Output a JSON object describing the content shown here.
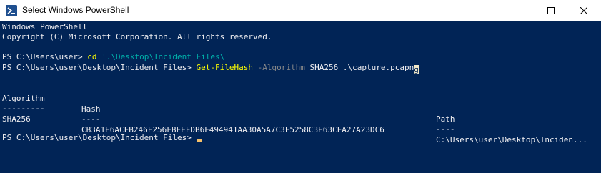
{
  "window": {
    "title": "Select Windows PowerShell",
    "controls": {
      "minimize": "minimize-icon",
      "maximize": "maximize-icon",
      "close": "close-icon"
    }
  },
  "colors": {
    "background": "#012456",
    "text": "#eeedf0",
    "command": "#ffff00",
    "string": "#00afa9",
    "parameter": "#8a8a8a"
  },
  "console": {
    "banner_line1": "Windows PowerShell",
    "banner_line2": "Copyright (C) Microsoft Corporation. All rights reserved.",
    "prompt1": "PS C:\\Users\\user> ",
    "cmd1_name": "cd",
    "cmd1_arg": " '.\\Desktop\\Incident Files\\'",
    "prompt2": "PS C:\\Users\\user\\Desktop\\Incident Files> ",
    "cmd2_name": "Get-FileHash",
    "cmd2_param": " -Algorithm",
    "cmd2_args": " SHA256 .\\capture.pcapn",
    "cmd2_last_char": "g",
    "table": {
      "headers": [
        "Algorithm",
        "Hash",
        "Path"
      ],
      "separators": [
        "---------",
        "----",
        "----"
      ],
      "rows": [
        [
          "SHA256",
          "CB3A1E6ACFB246F256FBFEFDB6F494941AA30A5A7C3F5258C3E63CFA27A23DC6",
          "C:\\Users\\user\\Desktop\\Inciden..."
        ]
      ]
    },
    "prompt3": "PS C:\\Users\\user\\Desktop\\Incident Files> "
  }
}
